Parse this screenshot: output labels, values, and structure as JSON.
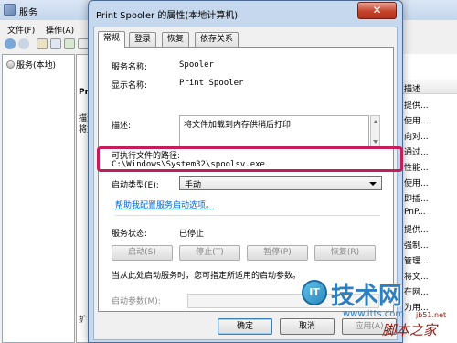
{
  "services_window": {
    "title": "服务",
    "menus": [
      "文件(F)",
      "操作(A)"
    ],
    "tree_item": "服务(本地)",
    "middle_fragments": [
      "Prin",
      "描述",
      "将文",
      "扩"
    ],
    "right_header": "描述",
    "right_rows": [
      "提供...",
      "使用...",
      "向对...",
      "通过...",
      "性能...",
      "使用...",
      "即插...",
      "PnP...",
      "提供...",
      "强制...",
      "管理...",
      "将文...",
      "在网...",
      "为用..."
    ]
  },
  "dialog": {
    "title": "Print Spooler 的属性(本地计算机)",
    "close_glyph": "✕",
    "tabs": [
      "常规",
      "登录",
      "恢复",
      "依存关系"
    ],
    "service_name_label": "服务名称:",
    "service_name_value": "Spooler",
    "display_name_label": "显示名称:",
    "display_name_value": "Print Spooler",
    "description_label": "描述:",
    "description_value": "将文件加载到内存供稍后打印",
    "exe_path_label": "可执行文件的路径:",
    "exe_path_value": "C:\\Windows\\System32\\spoolsv.exe",
    "startup_type_label": "启动类型(E):",
    "startup_type_value": "手动",
    "help_link": "帮助我配置服务启动选项。",
    "service_status_label": "服务状态:",
    "service_status_value": "已停止",
    "start_button": "启动(S)",
    "stop_button": "停止(T)",
    "pause_button": "暂停(P)",
    "resume_button": "恢复(R)",
    "start_hint": "当从此处启动服务时，您可指定所适用的启动参数。",
    "start_params_label": "启动参数(M):",
    "start_params_value": "",
    "ok_button": "确定",
    "cancel_button": "取消",
    "apply_button": "应用(A)"
  },
  "watermark": {
    "logo": "IT",
    "brand": "技术网",
    "url_a": "www.itts.com",
    "script_home": "脚本之家",
    "url_b": "jb51.net"
  },
  "colors": {
    "highlight": "#c41d5a",
    "link": "#0066cc",
    "close": "#c5442b"
  }
}
